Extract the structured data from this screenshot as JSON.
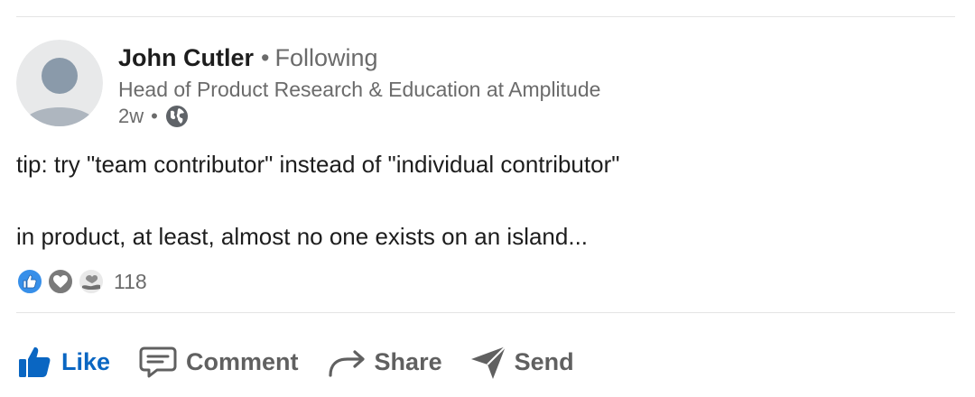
{
  "post": {
    "author": {
      "name": "John Cutler",
      "separator": "•",
      "follow_status": "Following",
      "headline": "Head of Product Research & Education at Amplitude",
      "time": "2w",
      "visibility_icon": "globe-icon"
    },
    "body": {
      "line1": "tip: try \"team contributor\" instead of \"individual contributor\"",
      "line2": "in product, at least, almost no one exists on an island..."
    },
    "reactions": {
      "icons": [
        "like-reaction-icon",
        "love-reaction-icon",
        "support-reaction-icon"
      ],
      "count": "118"
    },
    "actions": {
      "like": "Like",
      "comment": "Comment",
      "share": "Share",
      "send": "Send"
    }
  },
  "colors": {
    "accent": "#0a66c2",
    "secondary_text": "#6b6b6b",
    "action_text": "#606060",
    "divider": "#e4e4e4"
  }
}
